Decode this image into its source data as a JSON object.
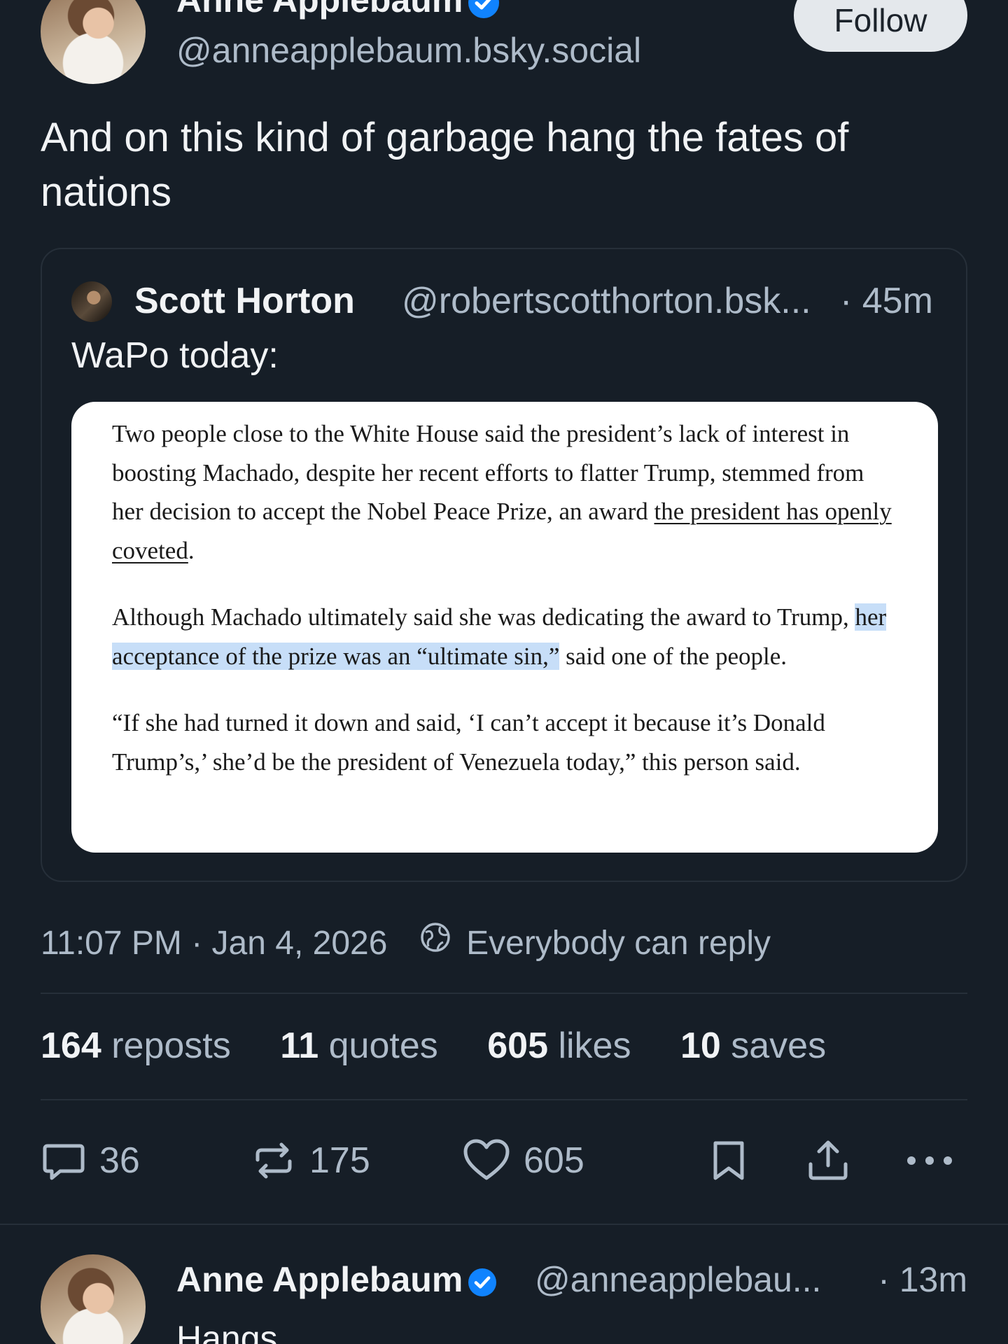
{
  "post": {
    "author_name": "Anne Applebaum",
    "handle": "@anneapplebaum.bsky.social",
    "follow_label": "Follow",
    "text": "And on this kind of garbage hang the fates of nations"
  },
  "quote": {
    "author_name": "Scott Horton",
    "handle": "@robertscotthorton.bsk...",
    "time": "· 45m",
    "text": "WaPo today:",
    "article": {
      "p1_before": "Two people close to the White House said the president’s lack of interest in boosting Machado, despite her recent efforts to flatter Trump, stemmed from her decision to accept the Nobel Peace Prize, an award ",
      "p1_link": "the president has openly coveted",
      "p1_after": ".",
      "p2_before": "Although Machado ultimately said she was dedicating the award to Trump, ",
      "p2_highlight": "her acceptance of the prize was an “ultimate sin,”",
      "p2_after": " said one of the people.",
      "p3": "“If she had turned it down and said, ‘I can’t accept it because it’s Donald Trump’s,’ she’d be the president of Venezuela today,” this person said."
    }
  },
  "meta": {
    "datetime": "11:07 PM · Jan 4, 2026",
    "reply_setting": "Everybody can reply"
  },
  "stats": [
    {
      "count": "164",
      "label": "reposts"
    },
    {
      "count": "11",
      "label": "quotes"
    },
    {
      "count": "605",
      "label": "likes"
    },
    {
      "count": "10",
      "label": "saves"
    }
  ],
  "actions": {
    "replies": "36",
    "reposts": "175",
    "likes": "605"
  },
  "reply": {
    "author_name": "Anne Applebaum",
    "handle": "@anneapplebau...",
    "time": "· 13m",
    "text": "Hangs"
  },
  "colors": {
    "background": "#161e27",
    "primary_text": "#f1f3f5",
    "secondary_text": "#aebbc9",
    "verified": "#1083fe",
    "highlight": "#c7def8"
  }
}
